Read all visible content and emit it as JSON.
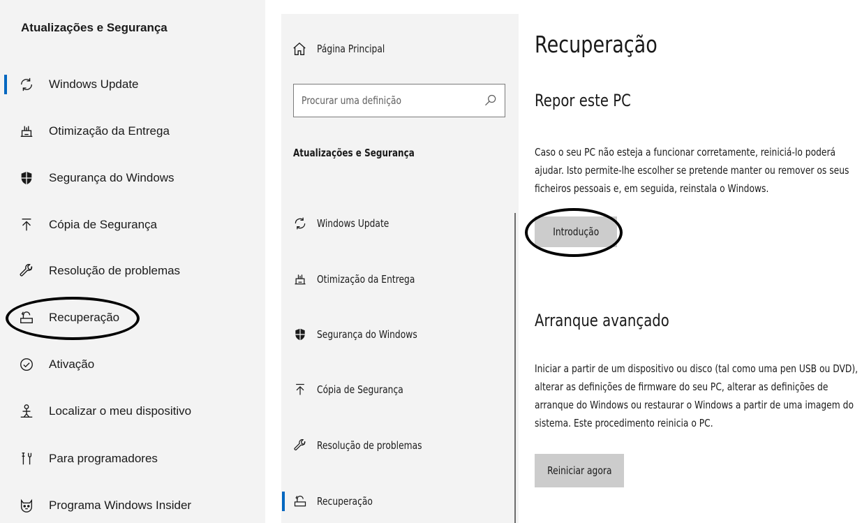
{
  "left_panel": {
    "title": "Atualizações e Segurança",
    "items": [
      {
        "label": "Windows Update",
        "icon": "sync-icon"
      },
      {
        "label": "Otimização da Entrega",
        "icon": "delivery-icon"
      },
      {
        "label": "Segurança do Windows",
        "icon": "shield-icon"
      },
      {
        "label": "Cópia de Segurança",
        "icon": "upload-icon"
      },
      {
        "label": "Resolução de problemas",
        "icon": "wrench-icon"
      },
      {
        "label": "Recuperação",
        "icon": "recovery-icon"
      },
      {
        "label": "Ativação",
        "icon": "check-circle-icon"
      },
      {
        "label": "Localizar o meu dispositivo",
        "icon": "person-locate-icon"
      },
      {
        "label": "Para programadores",
        "icon": "tools-icon"
      },
      {
        "label": "Programa Windows Insider",
        "icon": "insider-cat-icon"
      }
    ],
    "selected_index": 0
  },
  "nav": {
    "home_label": "Página Principal",
    "search_placeholder": "Procurar uma definição",
    "section_title": "Atualizações e Segurança",
    "items": [
      {
        "label": "Windows Update",
        "icon": "sync-icon"
      },
      {
        "label": "Otimização da Entrega",
        "icon": "delivery-icon"
      },
      {
        "label": "Segurança do Windows",
        "icon": "shield-icon"
      },
      {
        "label": "Cópia de Segurança",
        "icon": "upload-icon"
      },
      {
        "label": "Resolução de problemas",
        "icon": "wrench-icon"
      },
      {
        "label": "Recuperação",
        "icon": "recovery-icon"
      }
    ],
    "selected_index": 5
  },
  "content": {
    "title": "Recuperação",
    "reset": {
      "heading": "Repor este PC",
      "description": "Caso o seu PC não esteja a funcionar corretamente, reiniciá-lo poderá ajudar. Isto permite-lhe escolher se pretende manter ou remover os seus ficheiros pessoais e, em seguida, reinstala o Windows.",
      "button": "Introdução"
    },
    "advanced": {
      "heading": "Arranque avançado",
      "description": "Iniciar a partir de um dispositivo ou disco (tal como uma pen USB ou DVD), alterar as definições de firmware do seu PC, alterar as definições de arranque do Windows ou restaurar o Windows a partir de uma imagem do sistema. Este procedimento reinicia o PC.",
      "button": "Reiniciar agora"
    }
  },
  "colors": {
    "accent": "#0067c0",
    "panel_bg": "#f3f3f3",
    "button_bg": "#cccccc"
  }
}
